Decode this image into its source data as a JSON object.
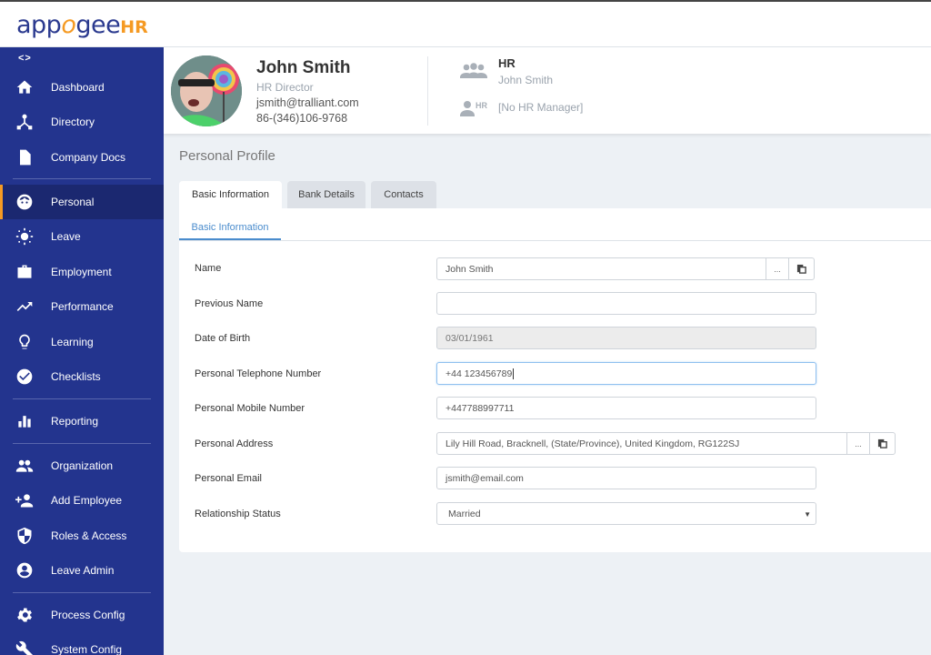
{
  "app": {
    "logo_main": "app",
    "logo_o": "o",
    "logo_rest": "gee",
    "logo_suffix": "HR",
    "colors": {
      "sidebar": "#23348e",
      "accent": "#f59a23",
      "link": "#4a8ccd"
    }
  },
  "sidebar": {
    "collapse_label": "<>",
    "items": [
      {
        "label": "Dashboard",
        "icon": "home-icon"
      },
      {
        "label": "Directory",
        "icon": "directory-icon"
      },
      {
        "label": "Company Docs",
        "icon": "document-icon"
      },
      {
        "label": "Personal",
        "icon": "face-icon",
        "active": true
      },
      {
        "label": "Leave",
        "icon": "sun-icon"
      },
      {
        "label": "Employment",
        "icon": "briefcase-icon"
      },
      {
        "label": "Performance",
        "icon": "trending-up-icon"
      },
      {
        "label": "Learning",
        "icon": "lightbulb-icon"
      },
      {
        "label": "Checklists",
        "icon": "check-circle-icon"
      },
      {
        "label": "Reporting",
        "icon": "bar-chart-icon"
      },
      {
        "label": "Organization",
        "icon": "people-icon"
      },
      {
        "label": "Add Employee",
        "icon": "add-person-icon"
      },
      {
        "label": "Roles & Access",
        "icon": "shield-icon"
      },
      {
        "label": "Leave Admin",
        "icon": "account-circle-icon"
      },
      {
        "label": "Process Config",
        "icon": "gear-icon"
      },
      {
        "label": "System Config",
        "icon": "wrench-icon"
      }
    ]
  },
  "employee": {
    "name": "John Smith",
    "title": "HR Director",
    "email": "jsmith@tralliant.com",
    "phone": "86-(346)106-9768",
    "department": "HR",
    "department_head": "John Smith",
    "hr_badge": "HR",
    "hr_manager": "[No HR Manager]"
  },
  "main": {
    "page_title": "Personal Profile",
    "tabs": [
      {
        "label": "Basic Information",
        "active": true
      },
      {
        "label": "Bank Details"
      },
      {
        "label": "Contacts"
      }
    ],
    "subtab": "Basic Information",
    "fields": [
      {
        "label": "Name",
        "value": "John Smith",
        "more": "..."
      },
      {
        "label": "Previous Name",
        "value": ""
      },
      {
        "label": "Date of Birth",
        "value": "03/01/1961"
      },
      {
        "label": "Personal Telephone Number",
        "value": "+44 123456789"
      },
      {
        "label": "Personal Mobile Number",
        "value": "+447788997711"
      },
      {
        "label": "Personal Address",
        "value": "Lily Hill Road, Bracknell, (State/Province), United Kingdom, RG122SJ",
        "more": "..."
      },
      {
        "label": "Personal Email",
        "value": "jsmith@email.com"
      },
      {
        "label": "Relationship Status",
        "value": "Married"
      }
    ]
  }
}
